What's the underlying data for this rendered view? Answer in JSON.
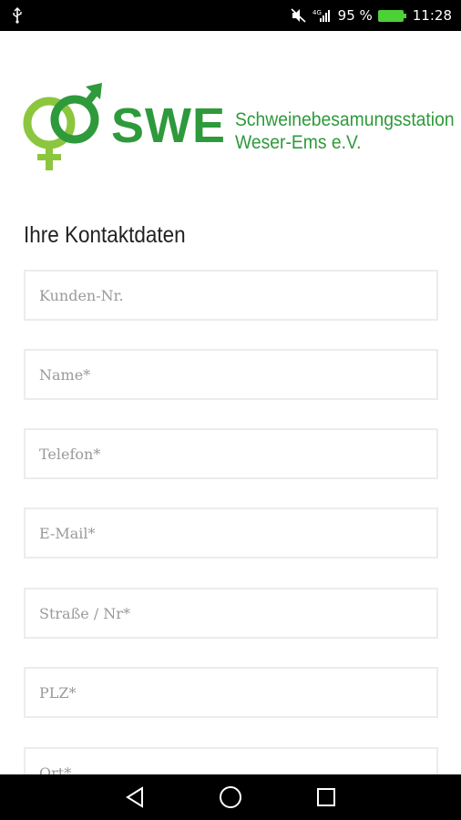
{
  "status_bar": {
    "usb_icon": "usb-icon",
    "network_label": "4G",
    "battery_percent": "95 %",
    "time": "11:28"
  },
  "logo": {
    "brand": "SWE",
    "subtitle_line1": "Schweinebesamungsstation",
    "subtitle_line2": "Weser-Ems e.V.",
    "primary_color": "#2e9a3b",
    "secondary_color": "#8cc63f"
  },
  "form": {
    "title": "Ihre Kontaktdaten",
    "fields": [
      {
        "placeholder": "Kunden-Nr."
      },
      {
        "placeholder": "Name*"
      },
      {
        "placeholder": "Telefon*"
      },
      {
        "placeholder": "E-Mail*"
      },
      {
        "placeholder": "Straße / Nr*"
      },
      {
        "placeholder": "PLZ*"
      },
      {
        "placeholder": "Ort*"
      }
    ]
  },
  "nav_bar": {
    "back": "back-icon",
    "home": "home-icon",
    "recents": "recents-icon"
  }
}
